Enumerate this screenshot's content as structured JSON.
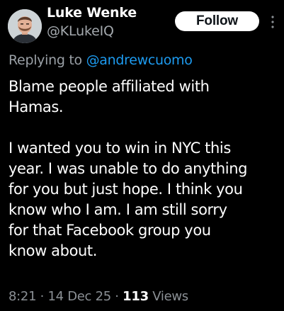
{
  "author": {
    "display_name": "Luke Wenke",
    "handle": "@KLukeIQ"
  },
  "follow_label": "Follow",
  "reply": {
    "prefix": "Replying to ",
    "mention": "@andrewcuomo"
  },
  "tweet": {
    "lines": [
      "Blame people affiliated with",
      "Hamas.",
      "",
      "I wanted you to win in NYC this",
      "year.  I was unable to do anything",
      "for you but just hope.  I think you",
      "know who I am.  I am still sorry",
      "for that Facebook group you",
      "know about."
    ]
  },
  "meta": {
    "time": "8:21",
    "separator": " · ",
    "date": "14 Dec 25",
    "views_count": "113",
    "views_label": " Views"
  },
  "colors": {
    "background": "#000000",
    "text": "#ffffff",
    "muted": "#8b9095",
    "link": "#1d9bf0",
    "button_bg": "#ffffff",
    "button_text": "#0f1419"
  },
  "icons": {
    "more": "more-vertical-icon",
    "avatar": "profile-photo"
  }
}
